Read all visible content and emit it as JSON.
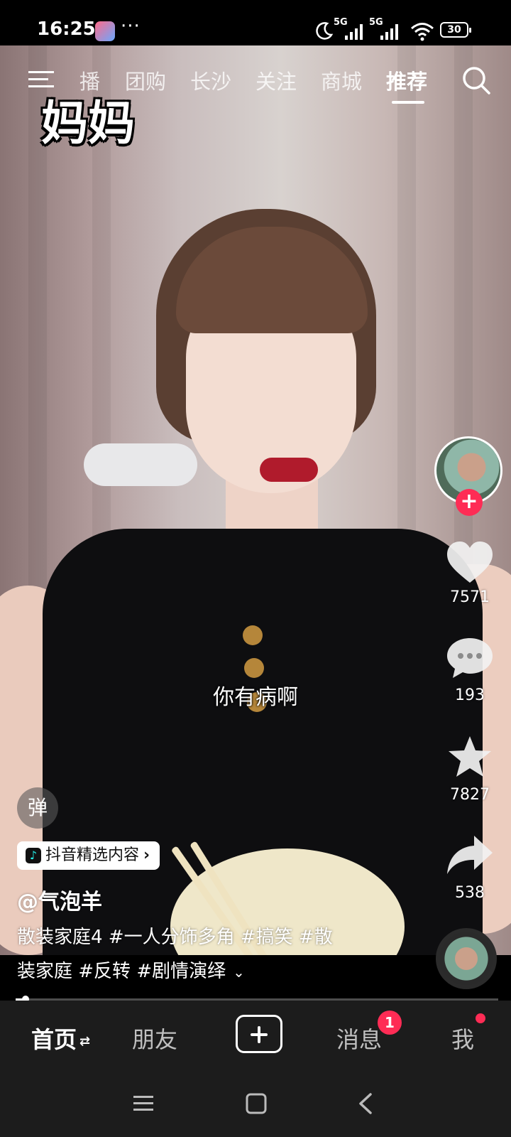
{
  "status_bar": {
    "time": "16:25",
    "more": "···",
    "signal1_label": "5G",
    "signal2_label": "5G",
    "battery": "30"
  },
  "top_nav": {
    "tabs": [
      "播",
      "团购",
      "长沙",
      "关注",
      "商城",
      "推荐"
    ],
    "active_tab": "推荐"
  },
  "video": {
    "overlay_title": "妈妈",
    "subtitle": "你有病啊"
  },
  "right_rail": {
    "likes": "7571",
    "comments": "193",
    "favorites": "7827",
    "shares": "538",
    "follow_icon": "plus-icon"
  },
  "info": {
    "danmu_label": "弹",
    "tag_label": "抖音精选内容",
    "author": "@气泡羊",
    "desc_line1": "散装家庭4 #一人分饰多角 #搞笑 #散",
    "desc_line2": "装家庭 #反转 #剧情演绎"
  },
  "progress": {
    "fraction": 0.02
  },
  "tabbar": {
    "home": "首页",
    "friends": "朋友",
    "messages": "消息",
    "messages_badge": "1",
    "me": "我"
  },
  "colors": {
    "accent": "#fe2c55",
    "tabbar_bg": "#1c1c1c"
  }
}
